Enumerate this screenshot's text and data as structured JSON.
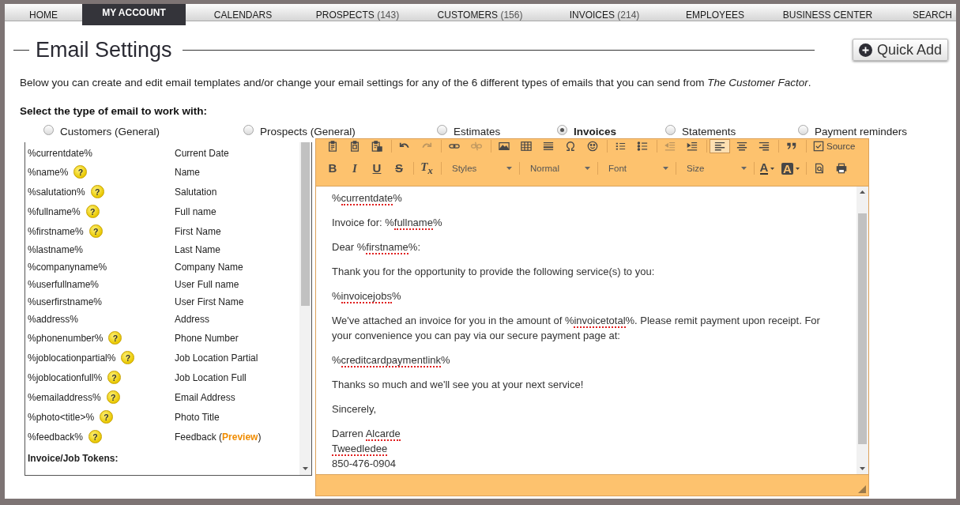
{
  "nav": [
    {
      "label": "HOME",
      "selected": false
    },
    {
      "label": "MY ACCOUNT",
      "selected": true
    },
    {
      "label": "CALENDARS",
      "selected": false
    },
    {
      "label": "PROSPECTS",
      "count": "(143)",
      "selected": false
    },
    {
      "label": "CUSTOMERS",
      "count": "(156)",
      "selected": false
    },
    {
      "label": "INVOICES",
      "count": "(214)",
      "selected": false
    },
    {
      "label": "EMPLOYEES",
      "selected": false
    },
    {
      "label": "BUSINESS CENTER",
      "selected": false
    },
    {
      "label": "SEARCH",
      "selected": false
    }
  ],
  "page": {
    "title": "Email Settings",
    "quick_add": "Quick Add",
    "intro": "Below you can create and edit email templates and/or change your email settings for any of the 6 different types of emails that you can send from *The Customer Factor*.",
    "type_prompt": "Select the type of email to work with:"
  },
  "email_types": [
    {
      "label": "Customers (General)",
      "selected": false
    },
    {
      "label": "Prospects (General)",
      "selected": false
    },
    {
      "label": "Estimates",
      "selected": false
    },
    {
      "label": "Invoices",
      "selected": true
    },
    {
      "label": "Statements",
      "selected": false
    },
    {
      "label": "Payment reminders",
      "selected": false
    }
  ],
  "tokens": {
    "items": [
      {
        "token": "%currentdate%",
        "description": "Current Date"
      },
      {
        "token": "%name%",
        "help": "?",
        "description": "Name"
      },
      {
        "token": "%salutation%",
        "help": "?",
        "description": "Salutation"
      },
      {
        "token": "%fullname%",
        "help": "?",
        "description": "Full name"
      },
      {
        "token": "%firstname%",
        "help": "?",
        "description": "First Name"
      },
      {
        "token": "%lastname%",
        "description": "Last Name"
      },
      {
        "token": "%companyname%",
        "description": "Company Name"
      },
      {
        "token": "%userfullname%",
        "description": "User Full name"
      },
      {
        "token": "%userfirstname%",
        "description": "User First Name"
      },
      {
        "token": "%address%",
        "description": "Address"
      },
      {
        "token": "%phonenumber%",
        "help": "?",
        "description": "Phone Number"
      },
      {
        "token": "%joblocationpartial%",
        "help": "?",
        "description": "Job Location Partial"
      },
      {
        "token": "%joblocationfull%",
        "help": "?",
        "description": "Job Location Full"
      },
      {
        "token": "%emailaddress%",
        "help": "?",
        "description": "Email Address"
      },
      {
        "token": "%photo<title>%",
        "help": "?",
        "description": "Photo Title"
      },
      {
        "token": "%feedback%",
        "help": "?",
        "description": "Feedback (",
        "link": "Preview",
        "description_end": ")"
      }
    ],
    "section_heading": "Invoice/Job Tokens:"
  },
  "editor": {
    "toolbar": [
      [
        [
          {
            "kind": "paste",
            "disabled": false,
            "selected": false
          },
          {
            "kind": "pastetext",
            "disabled": false,
            "selected": false
          },
          {
            "kind": "pasteword",
            "disabled": false,
            "selected": false
          }
        ],
        [
          {
            "kind": "undo",
            "disabled": false,
            "selected": false
          },
          {
            "kind": "redo",
            "disabled": true,
            "selected": false
          }
        ],
        [
          {
            "kind": "link",
            "disabled": false,
            "selected": false
          },
          {
            "kind": "unlink",
            "disabled": true,
            "selected": false
          }
        ],
        [
          {
            "kind": "image",
            "disabled": false,
            "selected": false
          },
          {
            "kind": "table",
            "disabled": false,
            "selected": false
          },
          {
            "kind": "rule",
            "disabled": false,
            "selected": false
          },
          {
            "kind": "symbol",
            "disabled": false,
            "selected": false
          },
          {
            "kind": "smiley",
            "disabled": false,
            "selected": false
          }
        ],
        [
          {
            "kind": "numbered",
            "disabled": false,
            "selected": false
          },
          {
            "kind": "bulleted",
            "disabled": false,
            "selected": false
          }
        ],
        [
          {
            "kind": "outdent",
            "disabled": true,
            "selected": false
          },
          {
            "kind": "indent",
            "disabled": false,
            "selected": false
          }
        ],
        [
          {
            "kind": "alignleft",
            "disabled": false,
            "selected": true
          },
          {
            "kind": "aligncenter",
            "disabled": false,
            "selected": false
          },
          {
            "kind": "alignright",
            "disabled": false,
            "selected": false
          }
        ],
        [
          {
            "kind": "quote",
            "disabled": false,
            "selected": false
          }
        ],
        [
          {
            "kind": "source",
            "label": "Source",
            "disabled": false,
            "selected": false
          }
        ]
      ],
      [
        [
          {
            "kind": "bold",
            "glyph": "B",
            "disabled": false,
            "selected": false
          },
          {
            "kind": "italic",
            "glyph": "I",
            "disabled": false,
            "selected": false
          },
          {
            "kind": "underline",
            "glyph": "U",
            "disabled": false,
            "selected": false
          },
          {
            "kind": "strike",
            "glyph": "S",
            "disabled": false,
            "selected": false
          }
        ],
        [
          {
            "kind": "clearformat",
            "glyph": "T$_{x}$",
            "disabled": false,
            "selected": false
          }
        ],
        [
          {
            "kind": "combo",
            "label": "Styles"
          }
        ],
        [
          {
            "kind": "combo",
            "label": "Normal"
          }
        ],
        [
          {
            "kind": "combo",
            "label": "Font"
          }
        ],
        [
          {
            "kind": "combo",
            "label": "Size"
          }
        ],
        [
          {
            "kind": "textcolor",
            "glyph": "A",
            "disabled": false,
            "selected": false
          },
          {
            "kind": "bgcolor",
            "glyph": "A",
            "disabled": false,
            "selected": false
          }
        ],
        [
          {
            "kind": "preview",
            "disabled": false,
            "selected": false
          },
          {
            "kind": "print",
            "disabled": false,
            "selected": false
          }
        ]
      ]
    ],
    "body": [
      {
        "lines": [
          [
            {
              "text": "%",
              "misspelled": false
            },
            {
              "text": "currentdate",
              "misspelled": true
            },
            {
              "text": "%",
              "misspelled": false
            }
          ]
        ]
      },
      {
        "lines": [
          [
            {
              "text": "Invoice for: %",
              "misspelled": false
            },
            {
              "text": "fullname",
              "misspelled": true
            },
            {
              "text": "%",
              "misspelled": false
            }
          ]
        ]
      },
      {
        "lines": [
          [
            {
              "text": "Dear %",
              "misspelled": false
            },
            {
              "text": "firstname",
              "misspelled": true
            },
            {
              "text": "%:",
              "misspelled": false
            }
          ]
        ]
      },
      {
        "lines": [
          [
            {
              "text": "Thank you for the opportunity to provide the following service(s) to you:",
              "misspelled": false
            }
          ]
        ]
      },
      {
        "lines": [
          [
            {
              "text": "%",
              "misspelled": false
            },
            {
              "text": "invoicejobs",
              "misspelled": true
            },
            {
              "text": "%",
              "misspelled": false
            }
          ]
        ]
      },
      {
        "lines": [
          [
            {
              "text": "We've attached an invoice for you in the amount of %",
              "misspelled": false
            },
            {
              "text": "invoicetotal",
              "misspelled": true
            },
            {
              "text": "%. Please remit payment upon receipt. For your convenience you can pay via our secure payment page at:",
              "misspelled": false
            }
          ]
        ]
      },
      {
        "lines": [
          [
            {
              "text": "%",
              "misspelled": false
            },
            {
              "text": "creditcardpaymentlink",
              "misspelled": true
            },
            {
              "text": "%",
              "misspelled": false
            }
          ]
        ]
      },
      {
        "lines": [
          [
            {
              "text": "Thanks so much and we'll see you at your next service!",
              "misspelled": false
            }
          ]
        ]
      },
      {
        "lines": [
          [
            {
              "text": "Sincerely,",
              "misspelled": false
            }
          ]
        ]
      },
      {
        "lines": [
          [
            {
              "text": "Darren ",
              "misspelled": false
            },
            {
              "text": "Alcarde",
              "misspelled": true
            }
          ],
          [
            {
              "text": "Tweedledee",
              "misspelled": true
            }
          ],
          [
            {
              "text": "850-476-0904",
              "misspelled": false
            }
          ]
        ]
      }
    ]
  }
}
